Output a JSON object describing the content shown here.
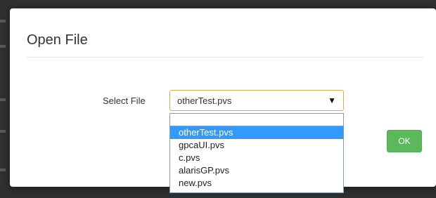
{
  "dialog": {
    "title": "Open File",
    "field_label": "Select File",
    "select": {
      "value": "otherTest.pvs",
      "options": [
        "otherTest.pvs",
        "gpcaUI.pvs",
        "c.pvs",
        "alarisGP.pvs",
        "new.pvs"
      ],
      "selected_index": 0
    },
    "ok_label": "OK",
    "colors": {
      "ok_button": "#5cb85c",
      "select_focus_border": "#e8a93f",
      "selected_option": "#3399ff"
    }
  }
}
